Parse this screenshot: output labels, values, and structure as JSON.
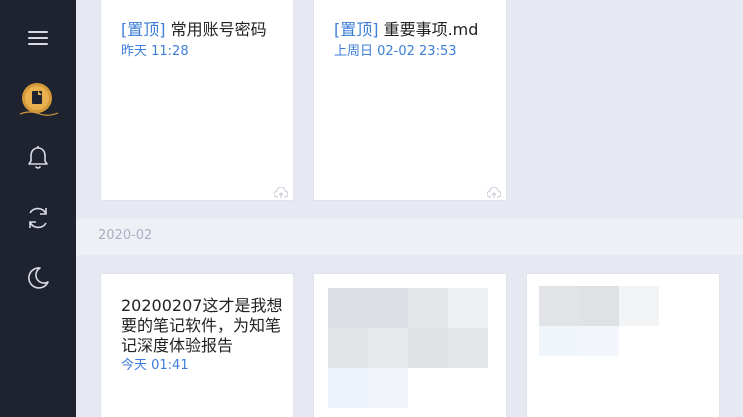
{
  "sidebar": {
    "menu_icon": "hamburger-menu-icon",
    "avatar_icon": "document-avatar-icon",
    "items": [
      {
        "name": "bell-icon"
      },
      {
        "name": "sync-icon"
      },
      {
        "name": "moon-icon"
      }
    ]
  },
  "colors": {
    "sidebar_bg": "#1f2330",
    "accent": "#3c7ed8",
    "page_bg": "#e6e9f2"
  },
  "pinned_notes": [
    {
      "pin_label": "[置顶]",
      "title": "常用账号密码",
      "time": "昨天 11:28"
    },
    {
      "pin_label": "[置顶]",
      "title": "重要事项.md",
      "time": "上周日 02-02 23:53"
    }
  ],
  "section": {
    "label": "2020-02"
  },
  "notes": [
    {
      "title": "20200207这才是我想要的笔记软件，为知笔记深度体验报告",
      "time": "今天 01:41"
    }
  ]
}
